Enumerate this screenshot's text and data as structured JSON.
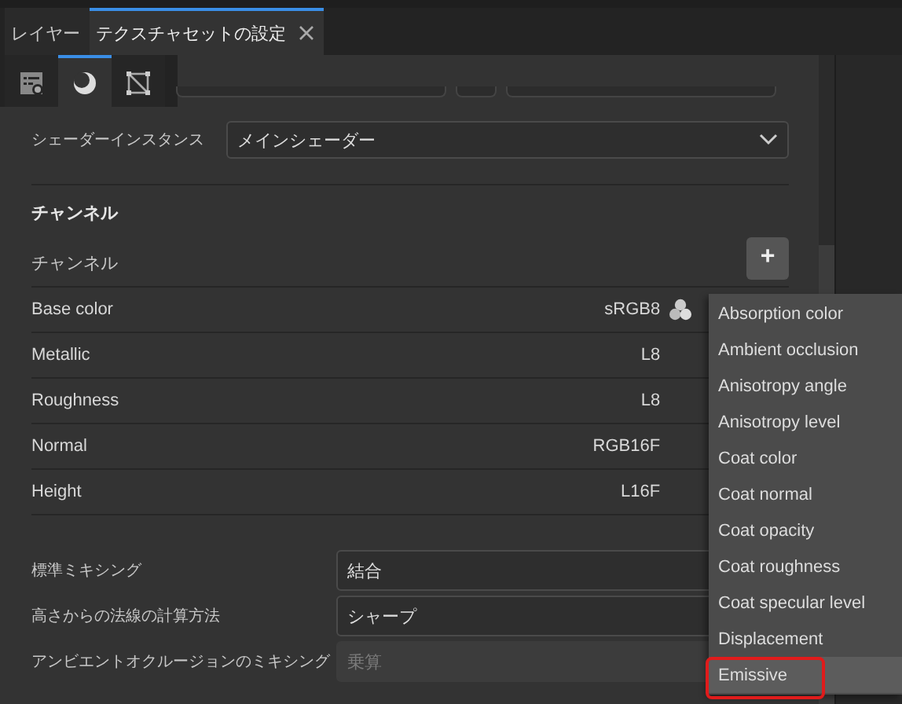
{
  "tabs": [
    {
      "label": "レイヤー",
      "selected": false,
      "closable": false
    },
    {
      "label": "テクスチャセットの設定",
      "selected": true,
      "closable": true
    }
  ],
  "tool_tabs": [
    {
      "kind": "settings",
      "selected": false
    },
    {
      "kind": "material",
      "selected": true
    },
    {
      "kind": "uv",
      "selected": false
    }
  ],
  "shader_instance": {
    "label": "シェーダーインスタンス",
    "value": "メインシェーダー"
  },
  "channels_section": {
    "title": "チャンネル",
    "header_label": "チャンネル",
    "add_button": "+",
    "channels": [
      {
        "name": "Base color",
        "format": "sRGB8",
        "kind": "color"
      },
      {
        "name": "Metallic",
        "format": "L8",
        "kind": "plain"
      },
      {
        "name": "Roughness",
        "format": "L8",
        "kind": "plain"
      },
      {
        "name": "Normal",
        "format": "RGB16F",
        "kind": "plain"
      },
      {
        "name": "Height",
        "format": "L16F",
        "kind": "plain"
      }
    ]
  },
  "mixing": [
    {
      "label": "標準ミキシング",
      "value": "結合",
      "disabled": false
    },
    {
      "label": "高さからの法線の計算方法",
      "value": "シャープ",
      "disabled": false
    },
    {
      "label": "アンビエントオクルージョンのミキシング",
      "value": "乗算",
      "disabled": true
    }
  ],
  "channel_menu": [
    {
      "label": "Absorption color",
      "selected": false
    },
    {
      "label": "Ambient occlusion",
      "selected": false
    },
    {
      "label": "Anisotropy angle",
      "selected": false
    },
    {
      "label": "Anisotropy level",
      "selected": false
    },
    {
      "label": "Coat color",
      "selected": false
    },
    {
      "label": "Coat normal",
      "selected": false
    },
    {
      "label": "Coat opacity",
      "selected": false
    },
    {
      "label": "Coat roughness",
      "selected": false
    },
    {
      "label": "Coat specular level",
      "selected": false
    },
    {
      "label": "Displacement",
      "selected": false
    },
    {
      "label": "Emissive",
      "selected": true
    }
  ]
}
